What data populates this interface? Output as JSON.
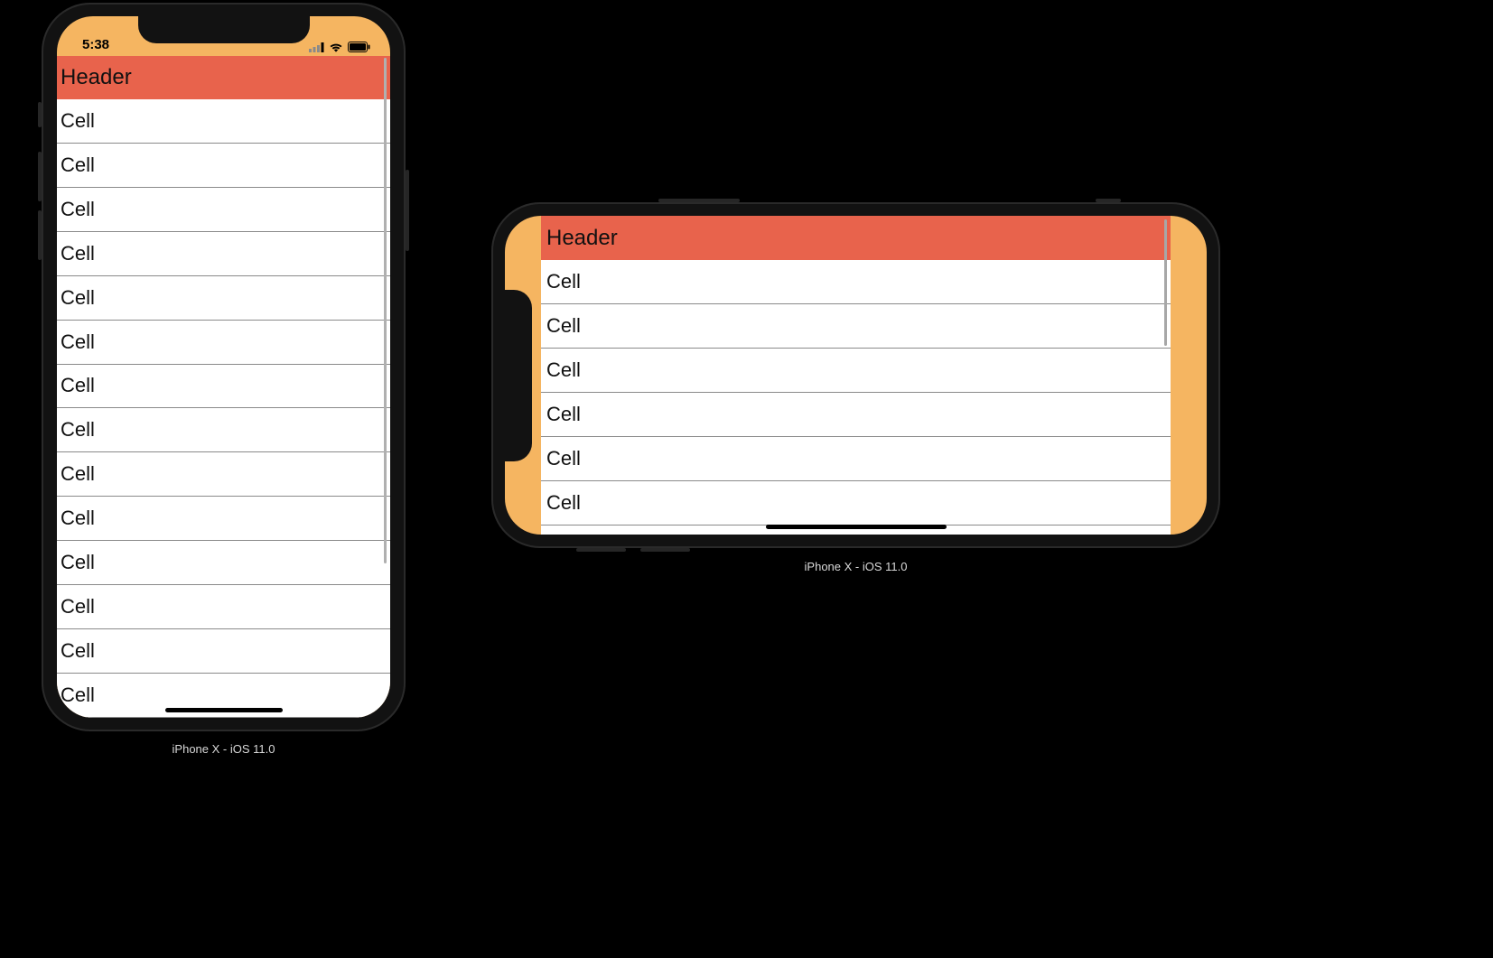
{
  "portrait": {
    "status_time": "5:38",
    "header": "Header",
    "cells": [
      "Cell",
      "Cell",
      "Cell",
      "Cell",
      "Cell",
      "Cell",
      "Cell",
      "Cell",
      "Cell",
      "Cell",
      "Cell",
      "Cell",
      "Cell",
      "Cell"
    ],
    "caption": "iPhone X - iOS 11.0"
  },
  "landscape": {
    "header": "Header",
    "cells": [
      "Cell",
      "Cell",
      "Cell",
      "Cell",
      "Cell",
      "Cell"
    ],
    "caption": "iPhone X - iOS 11.0"
  },
  "colors": {
    "background_tint": "#f5b561",
    "header_fill": "#e8634c",
    "page_bg": "#000000"
  }
}
